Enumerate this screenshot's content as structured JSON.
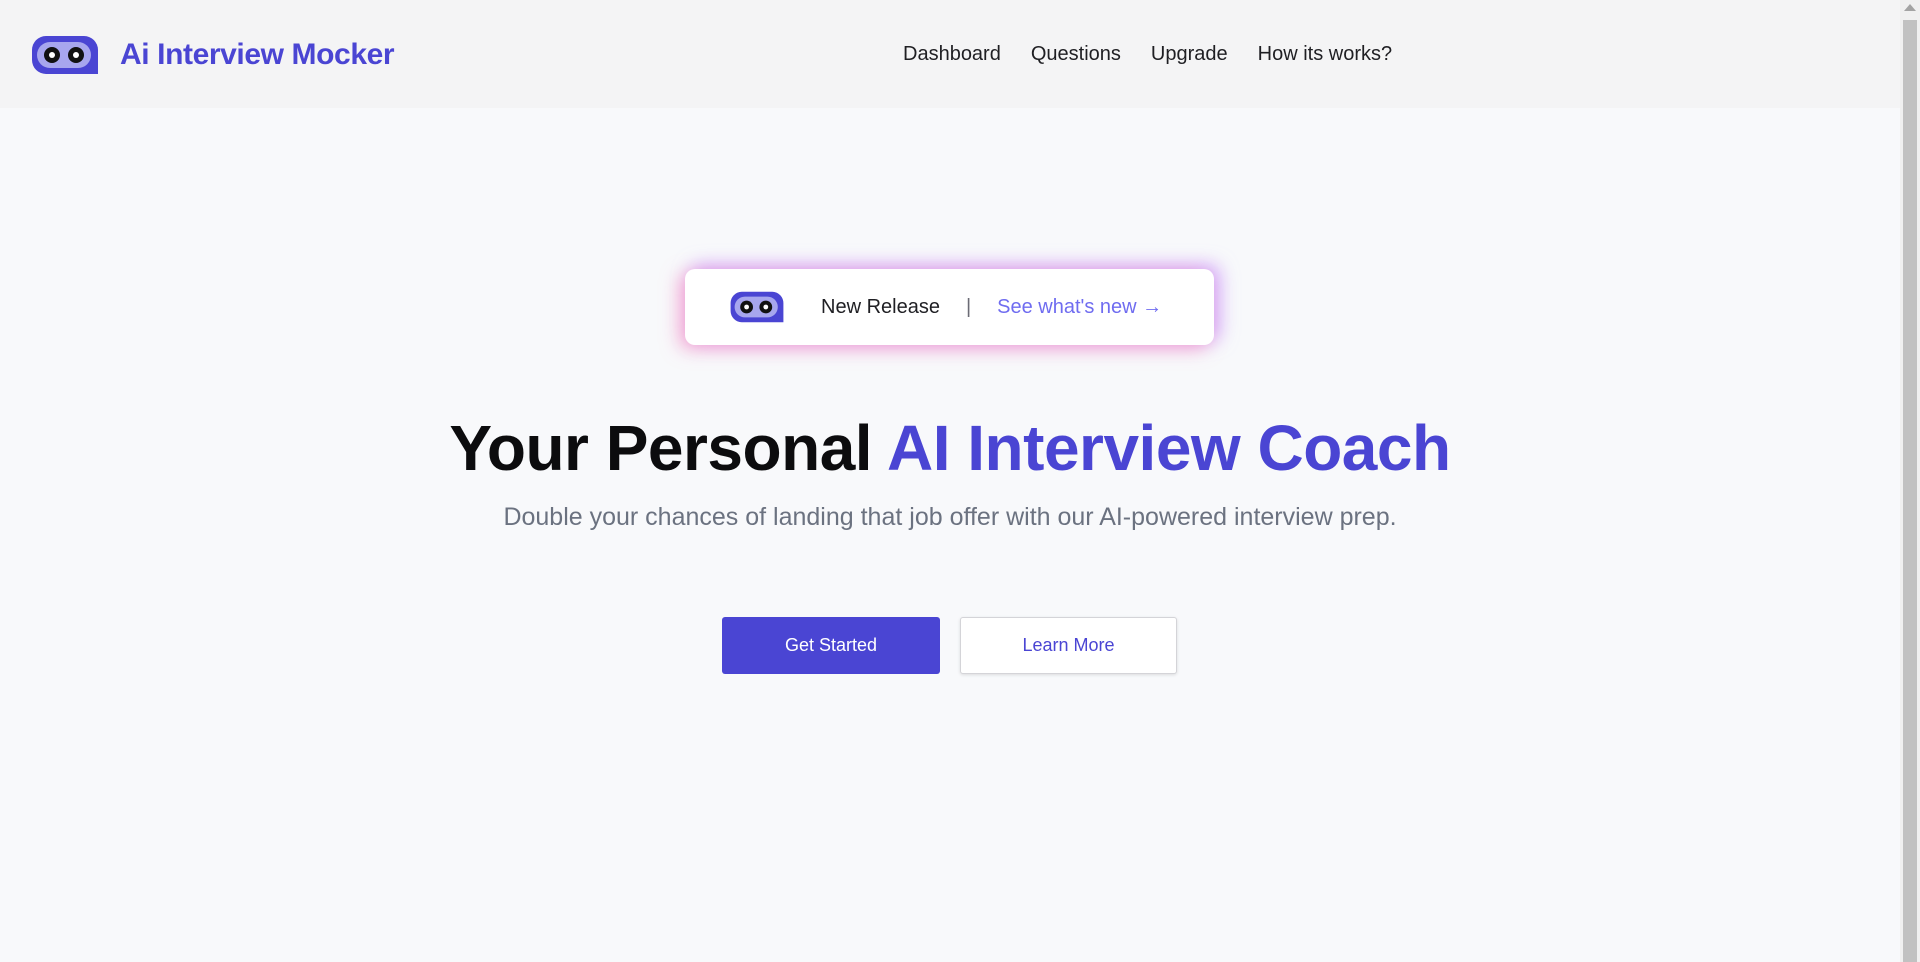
{
  "header": {
    "brand_name": "Ai Interview Mocker",
    "nav": [
      "Dashboard",
      "Questions",
      "Upgrade",
      "How its works?"
    ]
  },
  "hero": {
    "badge": {
      "release_label": "New Release",
      "separator": "|",
      "link_text": "See what's new →"
    },
    "headline_plain": "Your Personal ",
    "headline_accent": "AI Interview Coach",
    "subheadline": "Double your chances of landing that job offer with our AI-powered interview prep.",
    "primary_button": "Get Started",
    "secondary_button": "Learn More"
  },
  "icons": {
    "logo": "robot-eyes-logo-icon",
    "scroll_up": "scroll-up-arrow-icon"
  },
  "colors": {
    "brand": "#4a45d3",
    "badge_link": "#6f6cf0",
    "subheadline": "#6b7280",
    "badge_glow_left": "#f472b6",
    "badge_glow_right": "#c084fc"
  }
}
